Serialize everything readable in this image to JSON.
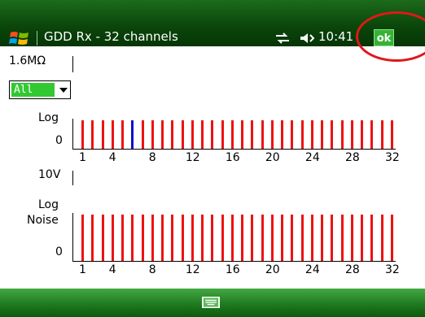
{
  "title_bar": {
    "app_title": "GDD Rx - 32 channels",
    "clock": "10:41",
    "ok_label": "ok",
    "icons": [
      "windows-start-icon",
      "sync-icon",
      "volume-icon"
    ]
  },
  "top_panel": {
    "resistance_label": "1.6MΩ",
    "channel_select": "All",
    "scale_label": "Log",
    "zero_label": "0",
    "tick_labels": [
      "1",
      "4",
      "8",
      "12",
      "16",
      "20",
      "24",
      "28",
      "32"
    ],
    "channels": 32,
    "highlighted_channel": 6
  },
  "bottom_panel": {
    "voltage_label": "10V",
    "scale_label": "Log",
    "noise_label": "Noise",
    "zero_label": "0",
    "tick_labels": [
      "1",
      "4",
      "8",
      "12",
      "16",
      "20",
      "24",
      "28",
      "32"
    ],
    "channels": 32
  },
  "colors": {
    "bar": "#ee1111",
    "highlight_bar": "#1010cc",
    "accent_green": "#32c832",
    "annotation_circle": "#e01818"
  },
  "bottom_bar": {
    "icon": "keyboard-icon"
  }
}
